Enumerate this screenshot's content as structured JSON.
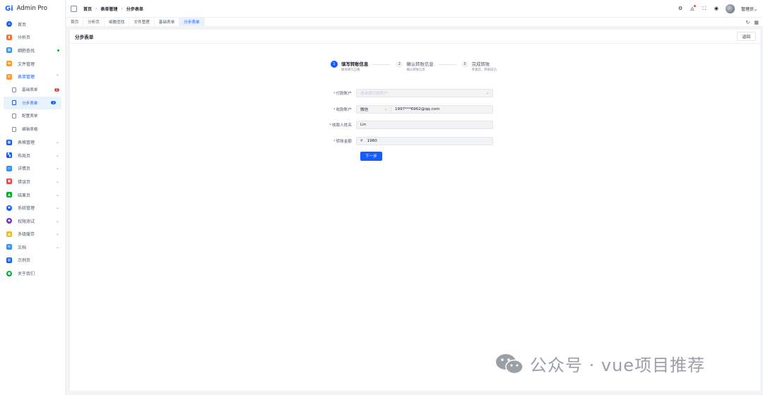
{
  "app": {
    "logo_mark": "Gi",
    "title": "Admin Pro"
  },
  "sidebar": {
    "items": [
      {
        "label": "首页",
        "color": "#165dff",
        "icon": "home-icon"
      },
      {
        "label": "分析页",
        "color": "#f77234",
        "icon": "chart-icon"
      },
      {
        "label": "细胞查找",
        "color": "#3491fa",
        "icon": "grid-icon"
      },
      {
        "label": "文件管理",
        "color": "#ff9a2e",
        "icon": "folder-icon"
      },
      {
        "label": "表单管理",
        "color": "#ff9a2e",
        "icon": "form-icon"
      },
      {
        "label": "表格管理",
        "color": "#165dff",
        "icon": "table-icon"
      },
      {
        "label": "布局页",
        "color": "#165dff",
        "icon": "layout-icon"
      },
      {
        "label": "详情页",
        "color": "#3491fa",
        "icon": "detail-icon"
      },
      {
        "label": "错误页",
        "color": "#f53f3f",
        "icon": "lock-icon"
      },
      {
        "label": "结果页",
        "color": "#00b42a",
        "icon": "result-icon"
      },
      {
        "label": "系统管理",
        "color": "#165dff",
        "icon": "settings-icon"
      },
      {
        "label": "权限测试",
        "color": "#722ed1",
        "icon": "shield-icon"
      },
      {
        "label": "多级缓存",
        "color": "#f7ba1e",
        "icon": "cache-icon"
      },
      {
        "label": "文档",
        "color": "#3491fa",
        "icon": "doc-icon"
      },
      {
        "label": "示例页",
        "color": "#165dff",
        "icon": "example-icon"
      },
      {
        "label": "关于我们",
        "color": "#00b42a",
        "icon": "about-icon"
      }
    ],
    "sub_items": [
      {
        "label": "基础表单",
        "badge": "1",
        "badge_color": "#f53f3f"
      },
      {
        "label": "分步表单",
        "badge": "3",
        "badge_color": "#165dff"
      },
      {
        "label": "配置表单"
      },
      {
        "label": "编辑表格"
      }
    ]
  },
  "header": {
    "breadcrumb": [
      "首页",
      "表单管理",
      "分步表单"
    ],
    "username": "管理员"
  },
  "tabs": [
    "首页",
    "分析页",
    "细胞查找",
    "文件管理",
    "基础表单",
    "分步表单"
  ],
  "card": {
    "title": "分步表单",
    "back_label": "返回"
  },
  "steps": [
    {
      "num": "1",
      "title": "填写转账信息",
      "desc": "确保填写正确"
    },
    {
      "num": "2",
      "title": "确认转账信息",
      "desc": "确认转账信息"
    },
    {
      "num": "3",
      "title": "完成转账",
      "desc": "恭喜您，转账成功"
    }
  ],
  "form": {
    "pay_account": {
      "label": "付款账户",
      "placeholder": "请选择付款账户"
    },
    "recv_account": {
      "label": "收款账户",
      "type": "微信",
      "value": "1997***6962@qq.com"
    },
    "recv_name": {
      "label": "收款人姓名",
      "value": "Lin"
    },
    "amount": {
      "label": "转账金额",
      "prefix": "¥",
      "value": "1980"
    },
    "next_label": "下一步"
  },
  "watermark": {
    "text": "公众号 · vue项目推荐"
  },
  "colors": {
    "primary": "#165dff",
    "danger": "#f53f3f",
    "success": "#00b42a"
  }
}
